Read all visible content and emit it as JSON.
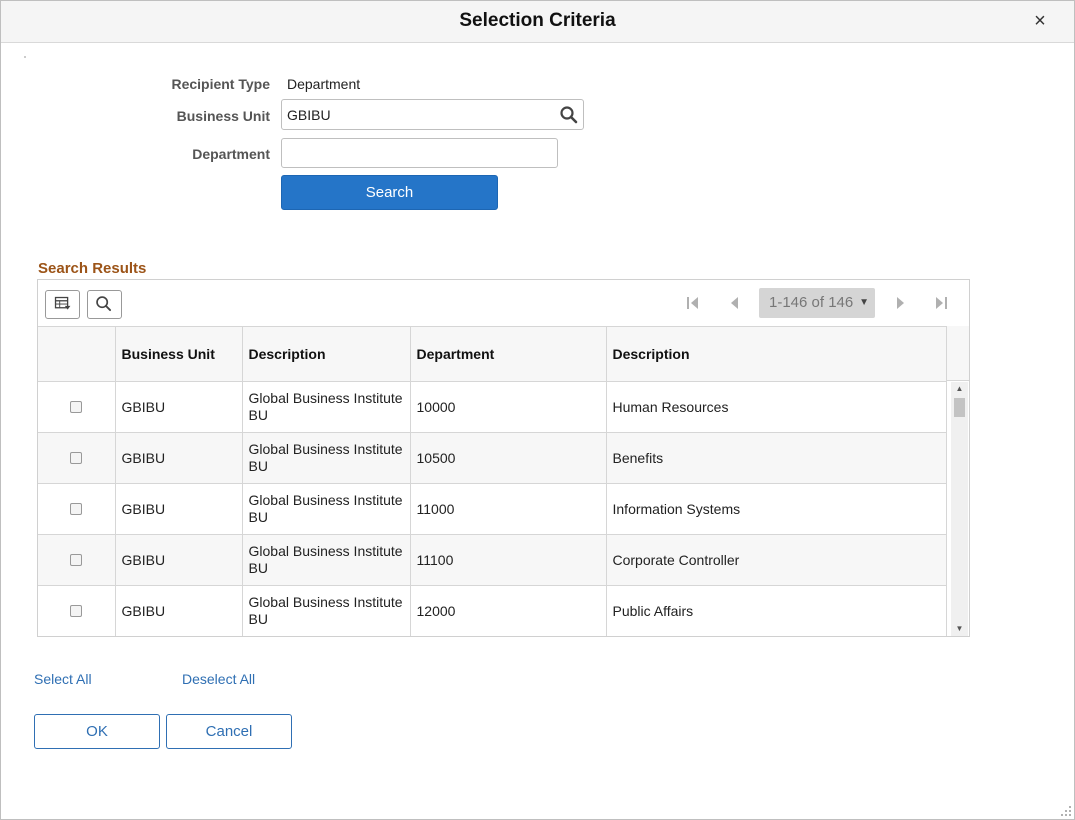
{
  "dialog": {
    "title": "Selection Criteria",
    "close_symbol": "×"
  },
  "criteria": {
    "recipient_type_label": "Recipient Type",
    "recipient_type_value": "Department",
    "business_unit_label": "Business Unit",
    "business_unit_value": "GBIBU",
    "department_label": "Department",
    "department_value": "",
    "search_button": "Search"
  },
  "results": {
    "title": "Search Results",
    "pager_text": "1-146 of 146",
    "columns": [
      "",
      "Business Unit",
      "Description",
      "Department",
      "Description"
    ],
    "rows": [
      {
        "business_unit": "GBIBU",
        "bu_description": "Global Business Institute BU",
        "department": "10000",
        "dept_description": "Human Resources"
      },
      {
        "business_unit": "GBIBU",
        "bu_description": "Global Business Institute BU",
        "department": "10500",
        "dept_description": "Benefits"
      },
      {
        "business_unit": "GBIBU",
        "bu_description": "Global Business Institute BU",
        "department": "11000",
        "dept_description": "Information Systems"
      },
      {
        "business_unit": "GBIBU",
        "bu_description": "Global Business Institute BU",
        "department": "11100",
        "dept_description": "Corporate Controller"
      },
      {
        "business_unit": "GBIBU",
        "bu_description": "Global Business Institute BU",
        "department": "12000",
        "dept_description": "Public Affairs"
      }
    ]
  },
  "actions": {
    "select_all": "Select All",
    "deselect_all": "Deselect All",
    "ok": "OK",
    "cancel": "Cancel"
  },
  "colors": {
    "primary_button": "#2575c8",
    "link": "#2f6fb3",
    "section_title": "#9c5418"
  }
}
